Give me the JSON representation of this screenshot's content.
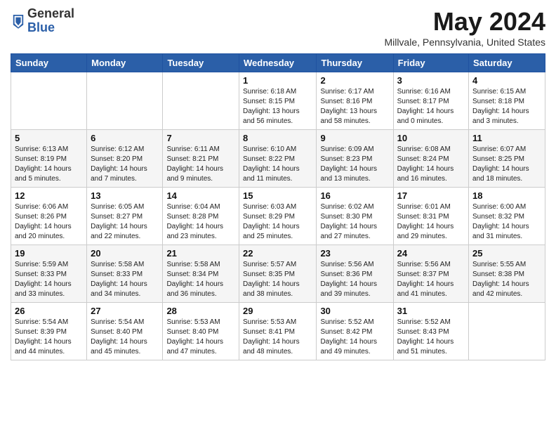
{
  "header": {
    "logo_general": "General",
    "logo_blue": "Blue",
    "month_title": "May 2024",
    "location": "Millvale, Pennsylvania, United States"
  },
  "weekdays": [
    "Sunday",
    "Monday",
    "Tuesday",
    "Wednesday",
    "Thursday",
    "Friday",
    "Saturday"
  ],
  "weeks": [
    [
      {
        "day": "",
        "info": ""
      },
      {
        "day": "",
        "info": ""
      },
      {
        "day": "",
        "info": ""
      },
      {
        "day": "1",
        "info": "Sunrise: 6:18 AM\nSunset: 8:15 PM\nDaylight: 13 hours\nand 56 minutes."
      },
      {
        "day": "2",
        "info": "Sunrise: 6:17 AM\nSunset: 8:16 PM\nDaylight: 13 hours\nand 58 minutes."
      },
      {
        "day": "3",
        "info": "Sunrise: 6:16 AM\nSunset: 8:17 PM\nDaylight: 14 hours\nand 0 minutes."
      },
      {
        "day": "4",
        "info": "Sunrise: 6:15 AM\nSunset: 8:18 PM\nDaylight: 14 hours\nand 3 minutes."
      }
    ],
    [
      {
        "day": "5",
        "info": "Sunrise: 6:13 AM\nSunset: 8:19 PM\nDaylight: 14 hours\nand 5 minutes."
      },
      {
        "day": "6",
        "info": "Sunrise: 6:12 AM\nSunset: 8:20 PM\nDaylight: 14 hours\nand 7 minutes."
      },
      {
        "day": "7",
        "info": "Sunrise: 6:11 AM\nSunset: 8:21 PM\nDaylight: 14 hours\nand 9 minutes."
      },
      {
        "day": "8",
        "info": "Sunrise: 6:10 AM\nSunset: 8:22 PM\nDaylight: 14 hours\nand 11 minutes."
      },
      {
        "day": "9",
        "info": "Sunrise: 6:09 AM\nSunset: 8:23 PM\nDaylight: 14 hours\nand 13 minutes."
      },
      {
        "day": "10",
        "info": "Sunrise: 6:08 AM\nSunset: 8:24 PM\nDaylight: 14 hours\nand 16 minutes."
      },
      {
        "day": "11",
        "info": "Sunrise: 6:07 AM\nSunset: 8:25 PM\nDaylight: 14 hours\nand 18 minutes."
      }
    ],
    [
      {
        "day": "12",
        "info": "Sunrise: 6:06 AM\nSunset: 8:26 PM\nDaylight: 14 hours\nand 20 minutes."
      },
      {
        "day": "13",
        "info": "Sunrise: 6:05 AM\nSunset: 8:27 PM\nDaylight: 14 hours\nand 22 minutes."
      },
      {
        "day": "14",
        "info": "Sunrise: 6:04 AM\nSunset: 8:28 PM\nDaylight: 14 hours\nand 23 minutes."
      },
      {
        "day": "15",
        "info": "Sunrise: 6:03 AM\nSunset: 8:29 PM\nDaylight: 14 hours\nand 25 minutes."
      },
      {
        "day": "16",
        "info": "Sunrise: 6:02 AM\nSunset: 8:30 PM\nDaylight: 14 hours\nand 27 minutes."
      },
      {
        "day": "17",
        "info": "Sunrise: 6:01 AM\nSunset: 8:31 PM\nDaylight: 14 hours\nand 29 minutes."
      },
      {
        "day": "18",
        "info": "Sunrise: 6:00 AM\nSunset: 8:32 PM\nDaylight: 14 hours\nand 31 minutes."
      }
    ],
    [
      {
        "day": "19",
        "info": "Sunrise: 5:59 AM\nSunset: 8:33 PM\nDaylight: 14 hours\nand 33 minutes."
      },
      {
        "day": "20",
        "info": "Sunrise: 5:58 AM\nSunset: 8:33 PM\nDaylight: 14 hours\nand 34 minutes."
      },
      {
        "day": "21",
        "info": "Sunrise: 5:58 AM\nSunset: 8:34 PM\nDaylight: 14 hours\nand 36 minutes."
      },
      {
        "day": "22",
        "info": "Sunrise: 5:57 AM\nSunset: 8:35 PM\nDaylight: 14 hours\nand 38 minutes."
      },
      {
        "day": "23",
        "info": "Sunrise: 5:56 AM\nSunset: 8:36 PM\nDaylight: 14 hours\nand 39 minutes."
      },
      {
        "day": "24",
        "info": "Sunrise: 5:56 AM\nSunset: 8:37 PM\nDaylight: 14 hours\nand 41 minutes."
      },
      {
        "day": "25",
        "info": "Sunrise: 5:55 AM\nSunset: 8:38 PM\nDaylight: 14 hours\nand 42 minutes."
      }
    ],
    [
      {
        "day": "26",
        "info": "Sunrise: 5:54 AM\nSunset: 8:39 PM\nDaylight: 14 hours\nand 44 minutes."
      },
      {
        "day": "27",
        "info": "Sunrise: 5:54 AM\nSunset: 8:40 PM\nDaylight: 14 hours\nand 45 minutes."
      },
      {
        "day": "28",
        "info": "Sunrise: 5:53 AM\nSunset: 8:40 PM\nDaylight: 14 hours\nand 47 minutes."
      },
      {
        "day": "29",
        "info": "Sunrise: 5:53 AM\nSunset: 8:41 PM\nDaylight: 14 hours\nand 48 minutes."
      },
      {
        "day": "30",
        "info": "Sunrise: 5:52 AM\nSunset: 8:42 PM\nDaylight: 14 hours\nand 49 minutes."
      },
      {
        "day": "31",
        "info": "Sunrise: 5:52 AM\nSunset: 8:43 PM\nDaylight: 14 hours\nand 51 minutes."
      },
      {
        "day": "",
        "info": ""
      }
    ]
  ]
}
